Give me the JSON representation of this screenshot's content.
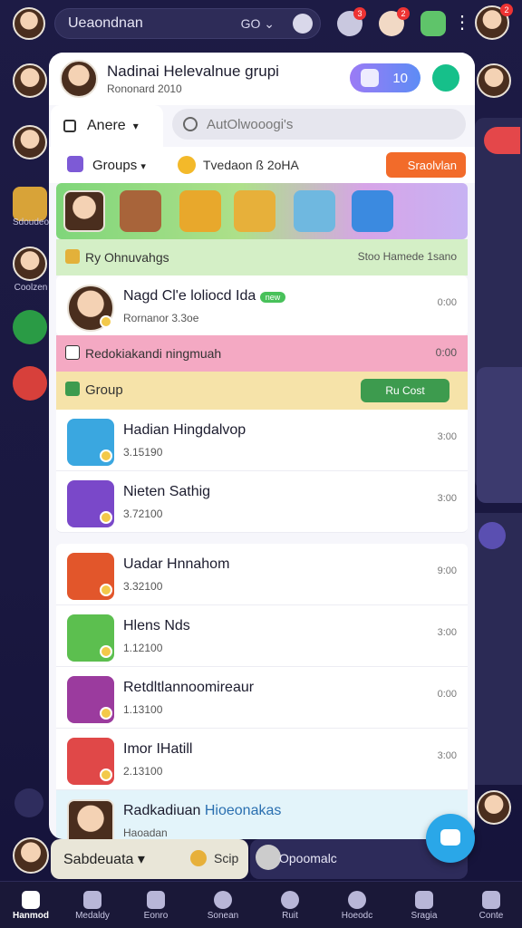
{
  "topbar": {
    "search_text": "Ueaondnan",
    "go_label": "GO",
    "chevron": "⌄",
    "more": "⋮",
    "icons": [
      "bell-icon",
      "user-icon",
      "smiley-icon",
      "game-icon"
    ]
  },
  "left_rail": {
    "labels": [
      "Sdoudeo",
      "Coolzen"
    ]
  },
  "panel": {
    "title": "Nadinai Helevalnue grupi",
    "subtitle": "Rononard 2010",
    "pill_value": "10",
    "tab_label": "Anere",
    "search_placeholder": "AutOlwooogi's",
    "groups_label": "Groups",
    "groups_mid": "Tvedaon ß 2oHA",
    "orange_button": "Sraolvlan",
    "section1": {
      "title": "Ry Ohnuvahgs",
      "right": "Stoo Hamede 1sano"
    },
    "row_top": {
      "name": "Nagd Cl'e loliocd Ida",
      "sub": "Rornanor 3.3oe",
      "time": "0:00",
      "tag": "new"
    },
    "section2": {
      "title": "Redokiakandi ningmuah",
      "right": "0:00"
    },
    "section3": {
      "title": "Group",
      "button": "Ru Cost"
    },
    "rows_a": [
      {
        "name": "Hadian Hingdalvop",
        "sub": "3.15190",
        "time": "3:00"
      },
      {
        "name": "Nieten Sathig",
        "sub": "3.72100",
        "time": "3:00"
      }
    ],
    "rows_b": [
      {
        "name": "Uadar Hnnahom",
        "sub": "3.32100",
        "time": "9:00"
      },
      {
        "name": "Hlens Nds",
        "sub": "1.12100",
        "time": "3:00"
      },
      {
        "name": "Retdltlannoomireaur",
        "sub": "1.13100",
        "time": "0:00"
      },
      {
        "name": "Imor IHatill",
        "sub": "2.13100",
        "time": "3:00"
      },
      {
        "name": "Radkadiuan",
        "sub2": "Hioeonakas",
        "sub": "Haoadan",
        "time": ""
      }
    ]
  },
  "bottom_chips": {
    "left": "Sabdeuata",
    "mid": "Scip",
    "right": "Opoomalc"
  },
  "nav": [
    {
      "label": "Hanmod",
      "active": true
    },
    {
      "label": "Medaldy",
      "active": false
    },
    {
      "label": "Eonro",
      "active": false
    },
    {
      "label": "Sonean",
      "active": false
    },
    {
      "label": "Ruit",
      "active": false
    },
    {
      "label": "Hoeodc",
      "active": false
    },
    {
      "label": "Sragia",
      "active": false
    },
    {
      "label": "Conte",
      "active": false
    }
  ],
  "colors": {
    "accent_purple": "#9b7bf5",
    "accent_green": "#16c08a",
    "orange": "#f26b2a",
    "fab": "#2aa7e8"
  }
}
